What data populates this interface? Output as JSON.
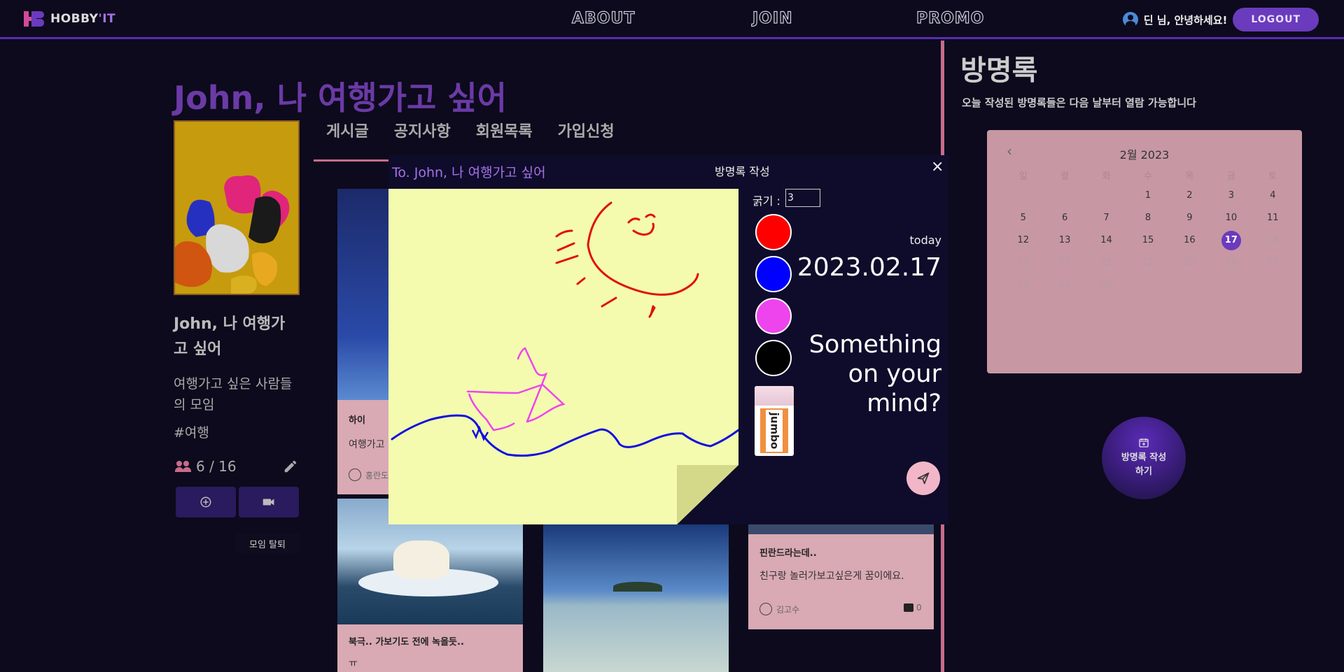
{
  "header": {
    "logo_text": "HOBBY",
    "logo_accent": "'IT",
    "nav": [
      "ABOUT",
      "JOIN",
      "PROMO"
    ],
    "greeting": "딘 님, 안녕하세요!",
    "logout_label": "LOGOUT"
  },
  "club": {
    "title": "John, 나 여행가고 싶어",
    "name": "John, 나 여행가고 싶어",
    "description": "여행가고 싶은 사람들의 모임",
    "tag": "#여행",
    "members": "6 / 16",
    "leave_label": "모임 탈퇴"
  },
  "tabs": [
    "게시글",
    "공지사항",
    "회원목록",
    "가입신청"
  ],
  "posts": [
    {
      "title": "하이",
      "text": "여행가고",
      "author": "홍란도"
    },
    {
      "title": "북극.. 가보기도 전에 녹을듯..",
      "text": "ㅠ"
    },
    {
      "title": "핀란드라는데..",
      "text": "친구랑 놀러가보고싶은게 꿈이에요.",
      "author": "김고수",
      "comments": "0"
    }
  ],
  "guestbook": {
    "title": "방명록",
    "subtitle": "오늘 작성된 방명록들은 다음 날부터 열람 가능합니다",
    "calendar": {
      "month": "2월 2023",
      "weekdays": [
        "일",
        "월",
        "화",
        "수",
        "목",
        "금",
        "토"
      ],
      "weeks": [
        [
          "",
          "",
          "",
          "1",
          "2",
          "3",
          "4"
        ],
        [
          "5",
          "6",
          "7",
          "8",
          "9",
          "10",
          "11"
        ],
        [
          "12",
          "13",
          "14",
          "15",
          "16",
          "17",
          "18"
        ],
        [
          "19",
          "20",
          "21",
          "22",
          "23",
          "24",
          "25"
        ],
        [
          "26",
          "27",
          "28",
          "",
          "",
          "",
          ""
        ]
      ],
      "today": "17"
    },
    "write_button": "방명록 작성하기"
  },
  "modal": {
    "to": "To. John, 나 여행가고 싶어",
    "title": "방명록 작성",
    "close": "×",
    "thickness_label": "굵기 :",
    "thickness_value": "3",
    "colors": [
      "#ff0000",
      "#0000ff",
      "#ee44ee",
      "#000000"
    ],
    "eraser_label": "jumbo",
    "today_label": "today",
    "today_date": "2023.02.17",
    "prompt": "Something on your mind?"
  }
}
